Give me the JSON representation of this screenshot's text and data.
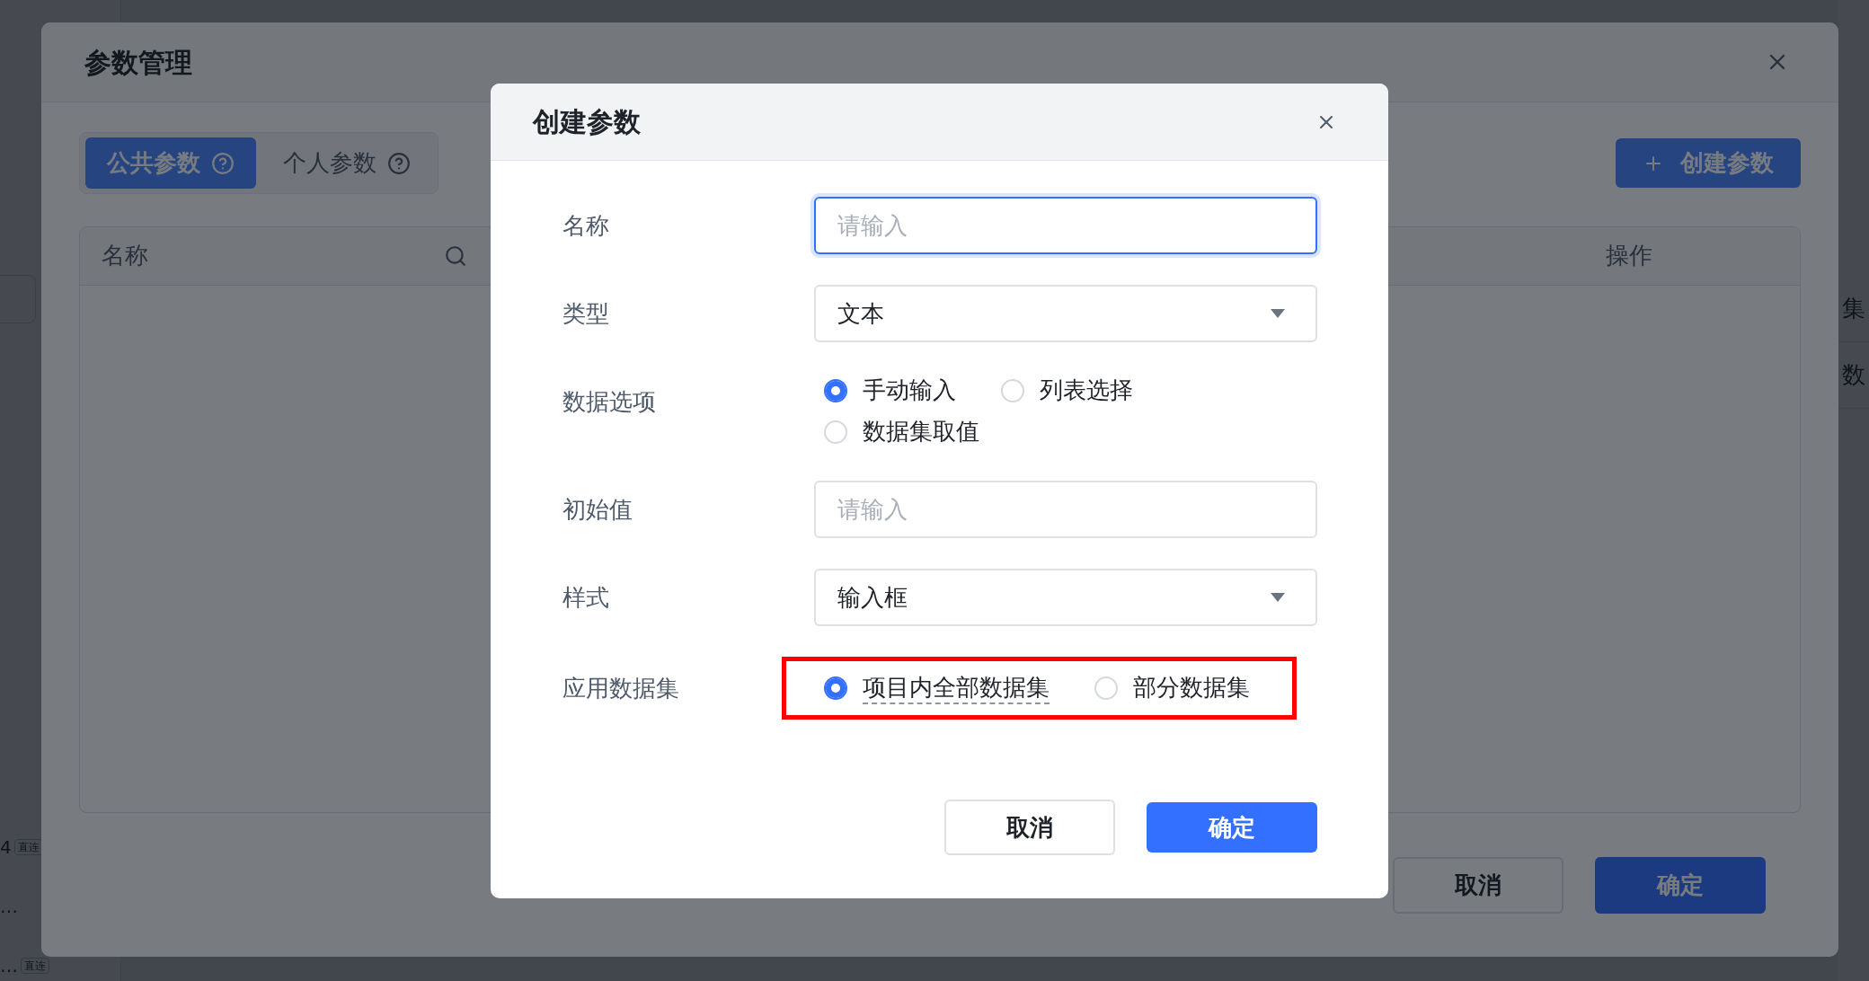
{
  "background_page": {
    "left_rows": [
      {
        "text": "4",
        "tag": "直连"
      },
      {
        "text": "…"
      },
      {
        "text": "…",
        "tag": "直连"
      }
    ],
    "right_rows": [
      "集",
      "数"
    ]
  },
  "parameter_manager": {
    "title": "参数管理",
    "tabs": [
      {
        "label": "公共参数",
        "selected": true
      },
      {
        "label": "个人参数",
        "selected": false
      }
    ],
    "create_button": "创建参数",
    "table": {
      "columns": [
        {
          "label": "名称",
          "searchable": true
        },
        {
          "label": "操作",
          "searchable": false
        }
      ]
    },
    "buttons": [
      {
        "label": "取消",
        "kind": "secondary"
      },
      {
        "label": "确定",
        "kind": "primary"
      }
    ]
  },
  "create_dialog": {
    "title": "创建参数",
    "fields": [
      {
        "label": "名称",
        "kind": "input",
        "placeholder": "请输入",
        "focused": true,
        "highlighted": false
      },
      {
        "label": "类型",
        "kind": "select",
        "value": "文本",
        "highlighted": false
      },
      {
        "label": "数据选项",
        "kind": "radio",
        "highlighted": false,
        "options": [
          {
            "label": "手动输入",
            "selected": true,
            "hint": false
          },
          {
            "label": "列表选择",
            "selected": false,
            "hint": false
          },
          {
            "label": "数据集取值",
            "selected": false,
            "hint": false
          }
        ]
      },
      {
        "label": "初始值",
        "kind": "input",
        "placeholder": "请输入",
        "focused": false,
        "highlighted": false
      },
      {
        "label": "样式",
        "kind": "select",
        "value": "输入框",
        "highlighted": false
      },
      {
        "label": "应用数据集",
        "kind": "radio",
        "highlighted": true,
        "options": [
          {
            "label": "项目内全部数据集",
            "selected": true,
            "hint": true
          },
          {
            "label": "部分数据集",
            "selected": false,
            "hint": false
          }
        ]
      }
    ],
    "buttons": [
      {
        "label": "取消",
        "kind": "secondary"
      },
      {
        "label": "确定",
        "kind": "primary"
      }
    ]
  }
}
